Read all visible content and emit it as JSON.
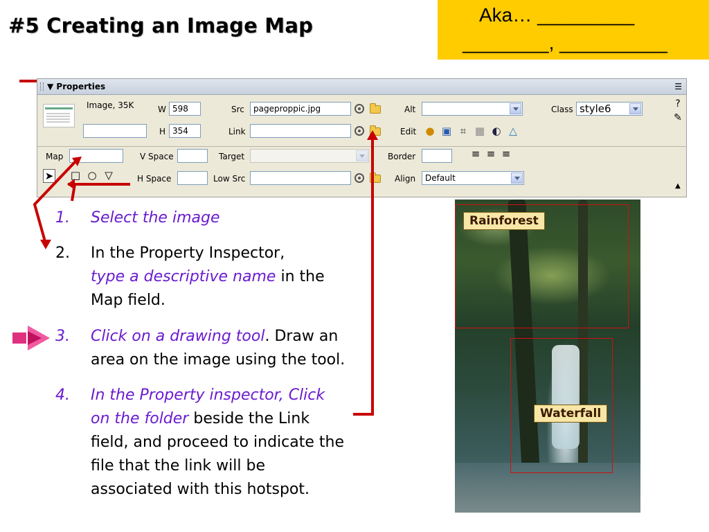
{
  "slide": {
    "title": "#5 Creating an Image Map",
    "aka_line1": "Aka… _________",
    "aka_line2": "________, __________"
  },
  "properties_panel": {
    "header": "▼ Properties",
    "image_label": "Image, 35K",
    "image_name_value": "",
    "w_label": "W",
    "w_value": "598",
    "h_label": "H",
    "h_value": "354",
    "src_label": "Src",
    "src_value": "pageproppic.jpg",
    "link_label": "Link",
    "link_value": "",
    "alt_label": "Alt",
    "alt_value": "",
    "edit_label": "Edit",
    "class_label": "Class",
    "class_value": "style6",
    "map_label": "Map",
    "map_value": "",
    "vspace_label": "V Space",
    "vspace_value": "",
    "hspace_label": "H Space",
    "hspace_value": "",
    "target_label": "Target",
    "target_value": "",
    "lowsrc_label": "Low Src",
    "lowsrc_value": "",
    "border_label": "Border",
    "border_value": "",
    "align_label": "Align",
    "align_value": "Default",
    "icons": [
      "point-to-file-icon",
      "folder-icon",
      "fireworks-icon",
      "optimize-icon",
      "crop-icon",
      "resample-icon",
      "brightness-icon",
      "sharpen-icon",
      "align-left-icon",
      "align-center-icon",
      "align-right-icon",
      "pointer-hotspot-tool-icon",
      "rectangle-hotspot-tool-icon",
      "circle-hotspot-tool-icon",
      "polygon-hotspot-tool-icon",
      "help-icon",
      "quick-tag-editor-icon",
      "options-menu-icon",
      "collapse-icon"
    ]
  },
  "steps": [
    {
      "num": "1.",
      "italic": "Select the image",
      "rest": ""
    },
    {
      "num": "2.",
      "line1": "In the Property Inspector,",
      "italic": "type a descriptive name",
      "rest": " in the",
      "line3": "Map field."
    },
    {
      "num": "3.",
      "italic": "Click on a drawing tool",
      "rest": ". Draw an",
      "line2": "area on the image using the tool."
    },
    {
      "num": "4.",
      "italic1": "In the Property inspector, Click",
      "italic2": "on the folder",
      "rest": " beside the Link",
      "line3": "field, and proceed to indicate the",
      "line4": "file that the link will be",
      "line5": "associated with this hotspot."
    }
  ],
  "photo": {
    "hotspot1_label": "Rainforest",
    "hotspot2_label": "Waterfall"
  },
  "colors": {
    "accent_purple": "#6a1bd0",
    "aka_box": "#ffcc00",
    "annotation_red": "#c80000"
  }
}
